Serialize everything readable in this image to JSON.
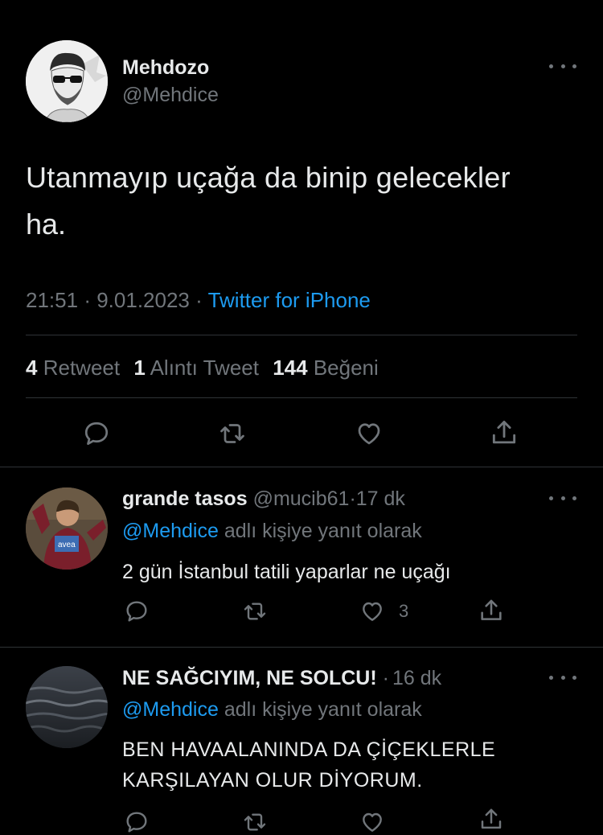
{
  "tweet": {
    "display_name": "Mehdozo",
    "handle": "@Mehdice",
    "text_line1": "Utanmayıp uçağa da binip gelecekler",
    "text_line2": "ha.",
    "time": "21:51",
    "sep1": "·",
    "date": "9.01.2023",
    "sep2": "·",
    "source": "Twitter for iPhone",
    "retweet_count": "4",
    "retweet_label": "Retweet",
    "quote_count": "1",
    "quote_label": "Alıntı Tweet",
    "like_count": "144",
    "like_label": "Beğeni",
    "icons": [
      "reply-icon",
      "retweet-icon",
      "like-icon",
      "share-icon"
    ]
  },
  "replies": [
    {
      "display_name": "grande tasos",
      "handle": "@mucib61",
      "sep": "·",
      "time": "17 dk",
      "reply_to_handle": "@Mehdice",
      "reply_to_suffix": "adlı kişiye yanıt olarak",
      "text_line1": "2 gün İstanbul tatili yaparlar ne uçağı",
      "text_line2": "",
      "like_count": "3",
      "avatar_text": "avea"
    },
    {
      "display_name": "NE SAĞCIYIM, NE SOLCU!",
      "handle": "",
      "sep": "·",
      "time": "16 dk",
      "reply_to_handle": "@Mehdice",
      "reply_to_suffix": "adlı kişiye yanıt olarak",
      "text_line1": "BEN HAVAALANINDA DA ÇİÇEKLERLE",
      "text_line2": "KARŞILAYAN OLUR DİYORUM.",
      "like_count": ""
    }
  ],
  "colors": {
    "background": "#000000",
    "text": "#e7e9ea",
    "muted": "#71767b",
    "link": "#1d9bf0",
    "divider": "#2f3336"
  }
}
